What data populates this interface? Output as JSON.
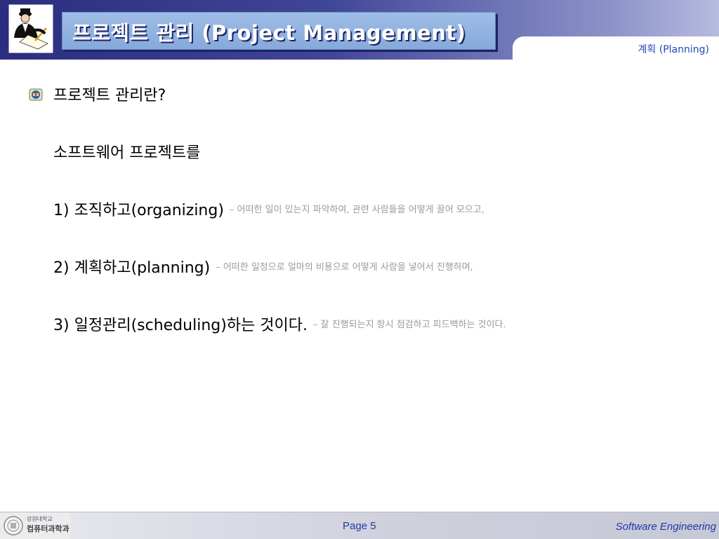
{
  "header": {
    "title": "프로젝트 관리 (Project Management)",
    "section": "계획 (Planning)"
  },
  "content": {
    "question": "프로젝트 관리란?",
    "intro": "소프트웨어 프로젝트를",
    "items": [
      {
        "number": "1)",
        "korean": "조직하고",
        "english": "(organizing)",
        "suffix": "",
        "note": "– 어떠한 일이 있는지 파악하여, 관련 사람들을 어떻게 끌어 모으고,"
      },
      {
        "number": "2)",
        "korean": "계획하고",
        "english": "(planning)",
        "suffix": "",
        "note": "– 어떠한 일정으로 얼마의 비용으로 어떻게 사람을 넣어서 진행하며,"
      },
      {
        "number": "3)",
        "korean": "일정관리",
        "english": "(scheduling)",
        "suffix": "하는 것이다.",
        "note": "– 잘 진행되는지 항시 점검하고 피드백하는 것이다."
      }
    ]
  },
  "footer": {
    "university": "강원대학교",
    "department": "컴퓨터과학과",
    "page": "Page 5",
    "course": "Software Engineering"
  },
  "icons": {
    "header_logo": "businessman-writing-icon",
    "bullet": "emblem-bullet-icon",
    "footer_emblem": "university-seal-icon"
  },
  "colors": {
    "header_dark": "#2b2e7e",
    "title_box": "#9fbde6",
    "section_label": "#1f47b8",
    "note_gray": "#9a9a9a",
    "footer_text": "#1f3aa8"
  }
}
